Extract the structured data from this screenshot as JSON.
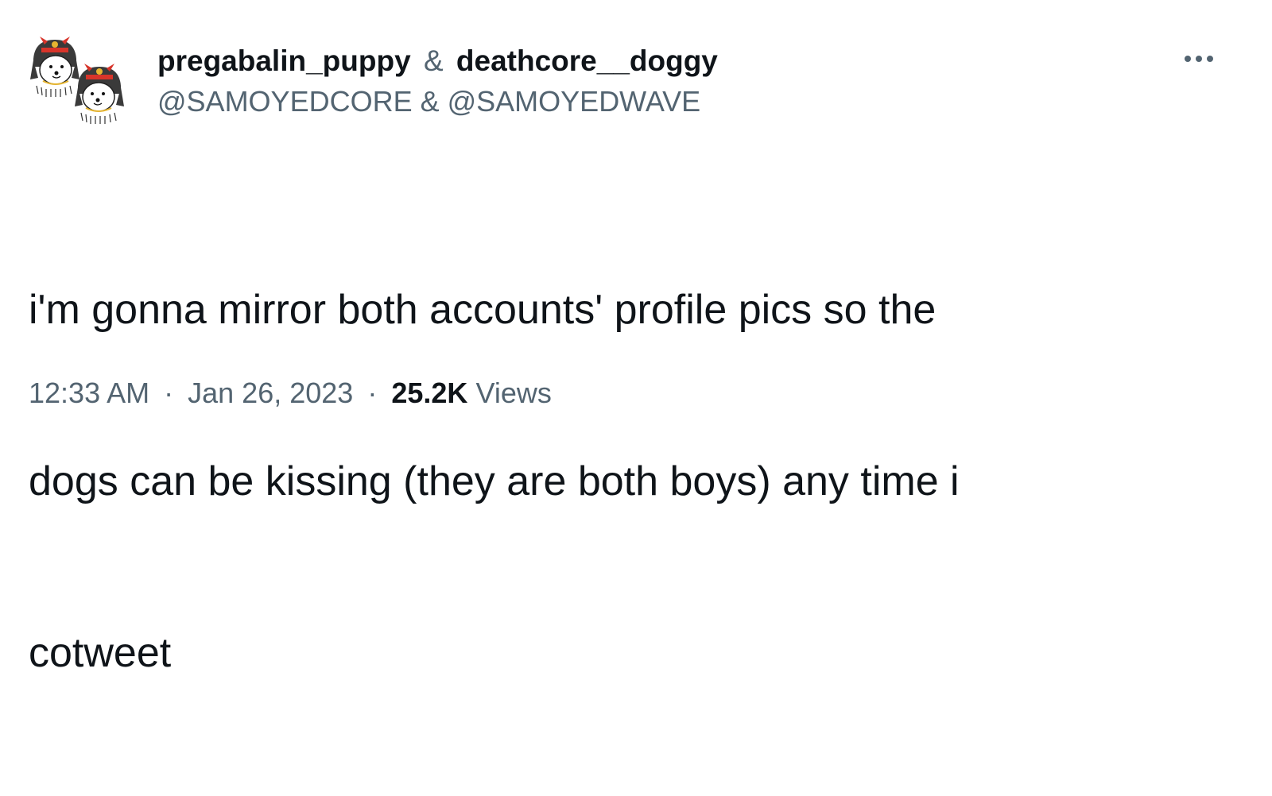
{
  "tweet": {
    "author_names": [
      "pregabalin_puppy",
      "deathcore__doggy"
    ],
    "author_joiner": "&",
    "handles_text": "@SAMOYEDCORE & @SAMOYEDWAVE",
    "text_lines": [
      "i'm gonna mirror both accounts' profile pics so the",
      "dogs can be kissing (they are both boys) any time i",
      "cotweet"
    ],
    "time": "12:33 AM",
    "date": "Jan 26, 2023",
    "separator": "·",
    "views_count": "25.2K",
    "views_label": "Views"
  },
  "icons": {
    "more": "more-horizontal-icon",
    "avatar_1": "samoyed-samurai-avatar",
    "avatar_2": "samoyed-samurai-avatar"
  },
  "colors": {
    "primary_text": "#0f1419",
    "secondary_text": "#536471",
    "helmet_red": "#d8342a",
    "helmet_gold": "#e6b530"
  }
}
